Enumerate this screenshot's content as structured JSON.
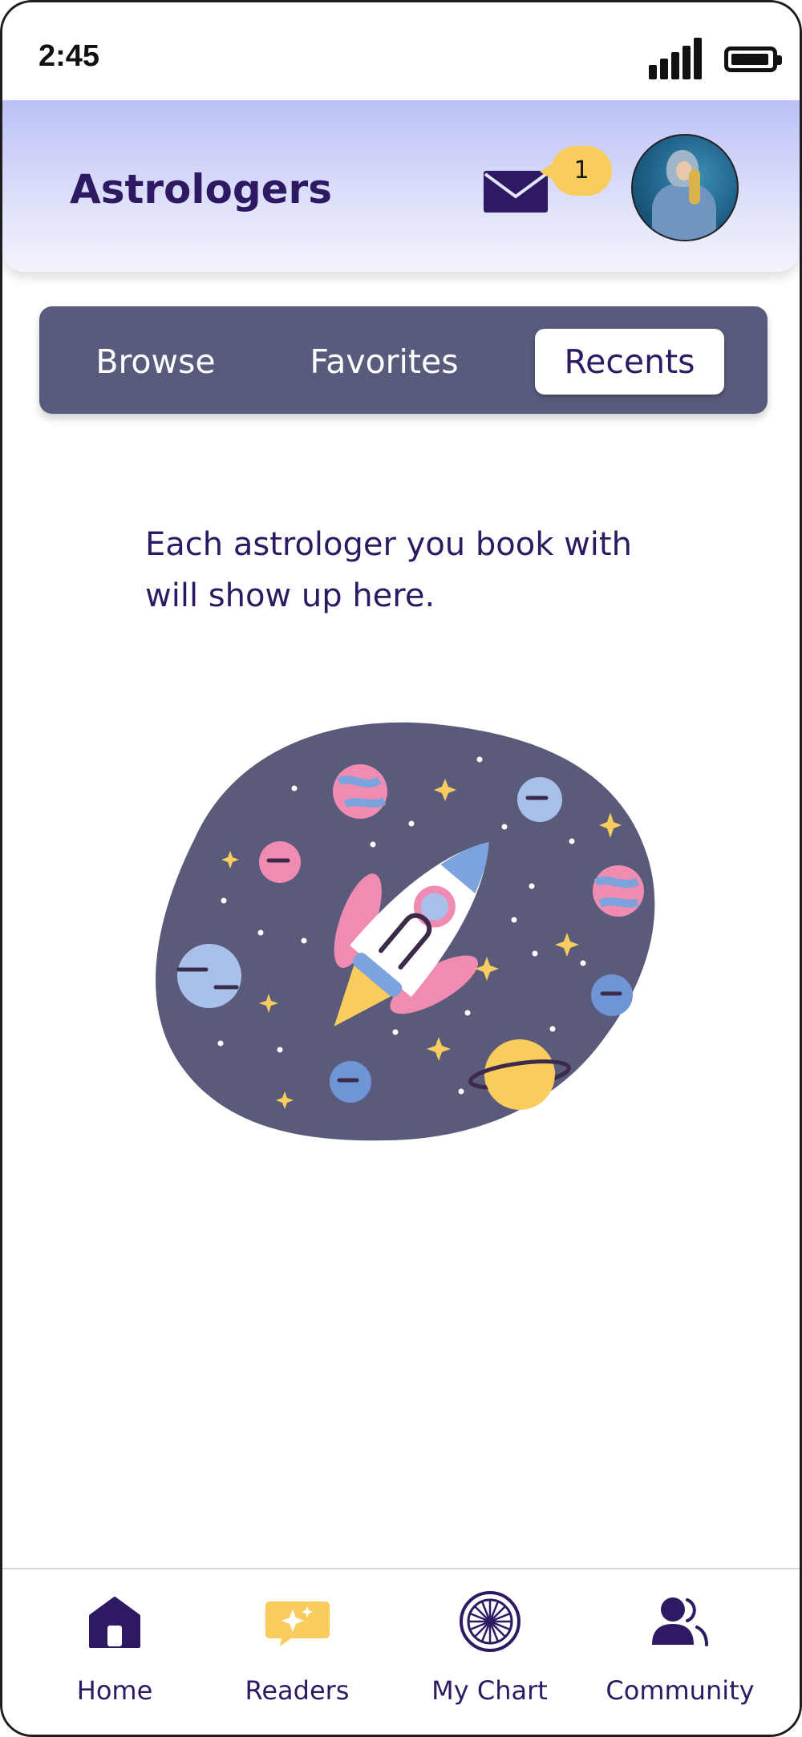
{
  "status_bar": {
    "time": "2:45"
  },
  "header": {
    "title": "Astrologers",
    "mail_icon": "mail-icon",
    "notification_count": "1",
    "avatar": "user-avatar"
  },
  "tabs": [
    {
      "label": "Browse",
      "selected": false
    },
    {
      "label": "Favorites",
      "selected": false
    },
    {
      "label": "Recents",
      "selected": true
    }
  ],
  "empty_state": {
    "message": "Each astrologer you book with will show up here.",
    "illustration": "rocket-in-space-illustration"
  },
  "bottom_nav": [
    {
      "label": "Home",
      "icon": "home-icon"
    },
    {
      "label": "Readers",
      "icon": "readers-sparkle-icon"
    },
    {
      "label": "My Chart",
      "icon": "zodiac-wheel-icon"
    },
    {
      "label": "Community",
      "icon": "community-icon"
    }
  ],
  "colors": {
    "primary": "#2d1a63",
    "tab_bar": "#595b7c",
    "badge": "#f8cd5e",
    "header_gradient_top": "#bcc1f6",
    "pink": "#f08bb2",
    "light_blue": "#a9c1ea",
    "mid_blue": "#6f95d6"
  }
}
